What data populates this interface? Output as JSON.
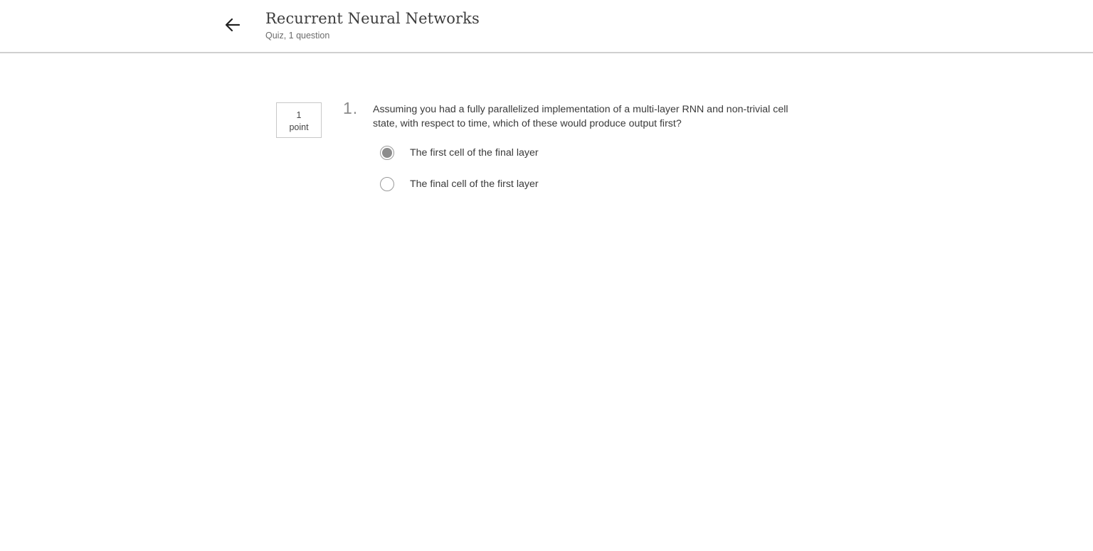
{
  "header": {
    "title": "Recurrent Neural Networks",
    "subtitle": "Quiz, 1 question",
    "back_icon": "arrow-left-icon"
  },
  "question": {
    "points_value": "1",
    "points_label": "point",
    "number": "1.",
    "text": "Assuming you had a fully parallelized implementation of a multi-layer RNN and non-trivial cell state, with respect to time, which of these would produce output first?",
    "options": [
      {
        "label": "The first cell of the final layer",
        "selected": true
      },
      {
        "label": "The final cell of the first layer",
        "selected": false
      }
    ]
  },
  "colors": {
    "header_border": "#d0d0d0",
    "selected_radio": "#8c8c8c",
    "text": "#3a3a3a"
  }
}
